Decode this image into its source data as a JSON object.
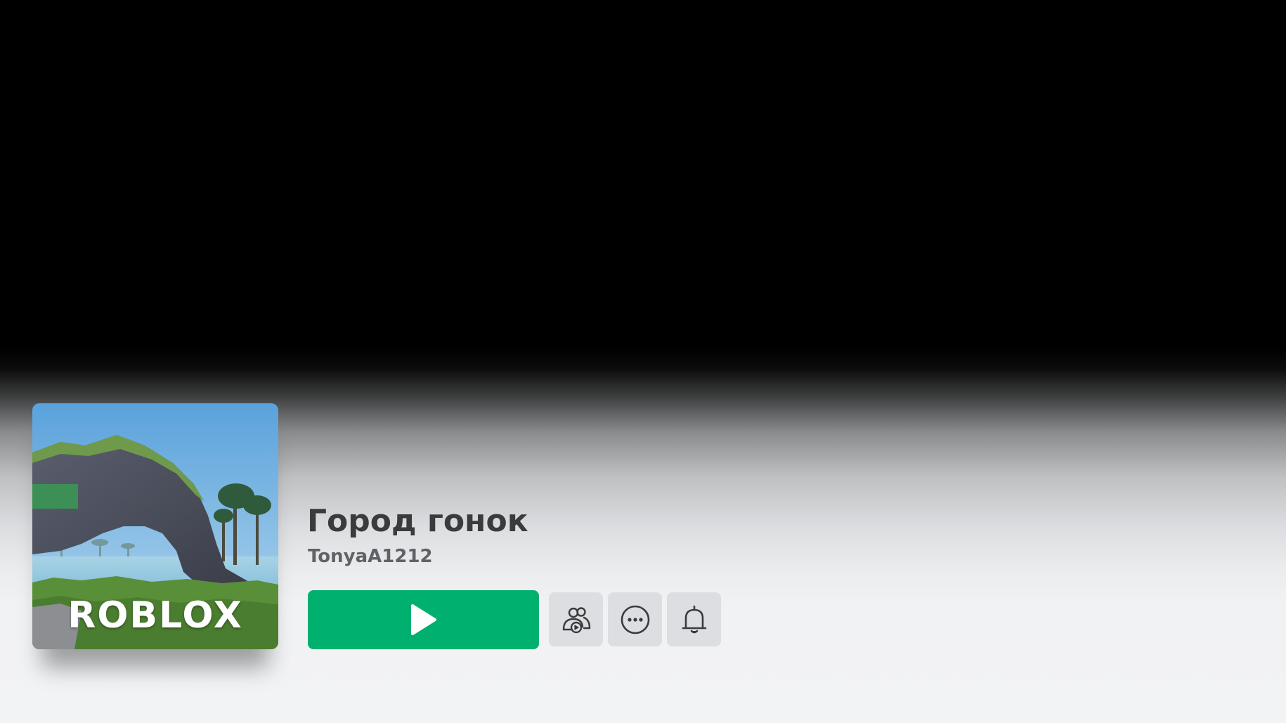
{
  "game": {
    "title": "Город гонок",
    "creator": "TonyaA1212",
    "thumbnail_logo": "ROBLOX"
  },
  "actions": {
    "play": {
      "icon": "play-icon",
      "color": "#00b06f"
    },
    "party": {
      "icon": "party-icon"
    },
    "more": {
      "icon": "more-options-icon"
    },
    "notify": {
      "icon": "bell-icon"
    }
  },
  "colors": {
    "play_green": "#00b06f",
    "button_gray": "#dcdee1",
    "title_text": "#393b3d",
    "creator_text": "#5f6266"
  }
}
